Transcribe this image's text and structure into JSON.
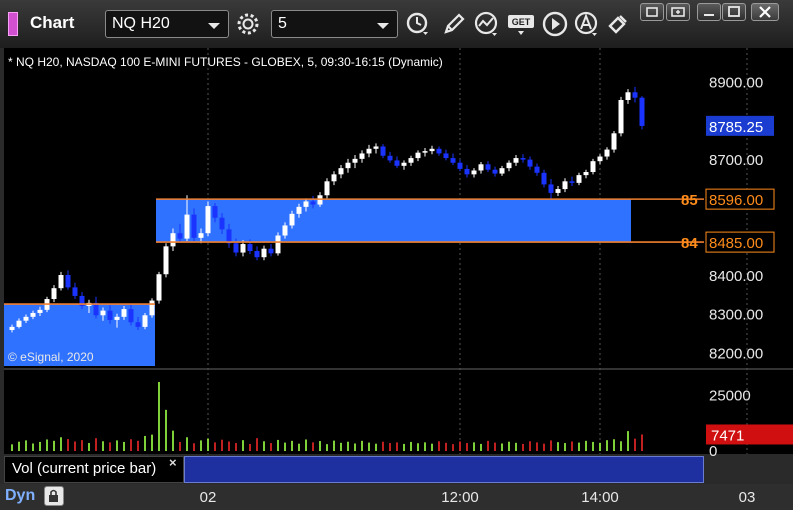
{
  "toolbar": {
    "app_title": "Chart",
    "symbol": "NQ H20",
    "interval": "5",
    "icons": [
      "symbol-dropdown-icon",
      "settings-gear-icon",
      "interval-dropdown-icon",
      "clock-icon",
      "pencil-draw-icon",
      "studies-icon",
      "get-data-icon",
      "play-icon",
      "alert-a-icon",
      "link-chain-icon"
    ],
    "window_buttons": [
      "restore-icon",
      "dock-icon",
      "maximize-icon",
      "close-icon"
    ]
  },
  "chart": {
    "header": "* NQ H20, NASDAQ 100 E-MINI FUTURES - GLOBEX, 5, 09:30-16:15 (Dynamic)",
    "copyright": "© eSignal, 2020",
    "current_price": "8785.25",
    "level_high_value": "8596.00",
    "level_high_tag": "85",
    "level_low_value": "8485.00",
    "level_low_tag": "84",
    "volume_last": "7471",
    "legend_label": "Vol (current price bar)",
    "legend_close": "×",
    "mode_label": "Dyn",
    "colors": {
      "background": "#000000",
      "up_candle": "#ffffff",
      "down_candle": "#1a33ff",
      "zone_fill": "#2f72ff",
      "level_line": "#f08030",
      "level_text": "#ff8c1a",
      "current_price_box": "#1a3cd0",
      "volume_up": "#7fd13a",
      "volume_down": "#c02020",
      "volume_box": "#d01010"
    }
  },
  "chart_data": [
    {
      "type": "candlestick",
      "title": "* NQ H20, NASDAQ 100 E-MINI FUTURES - GLOBEX, 5, 09:30-16:15 (Dynamic)",
      "y_ticks": [
        8200,
        8300,
        8400,
        8500,
        8600,
        8700,
        8800,
        8900
      ],
      "y_tick_labels": [
        "8200.00",
        "8300.00",
        "8400.00",
        "8500.00",
        "8600.00",
        "8700.00",
        "8800.00",
        "8900.00"
      ],
      "ylim": [
        8165,
        8945
      ],
      "x_tick_labels": [
        "02",
        "12:00",
        "14:00",
        "03"
      ],
      "x_tick_bars": [
        28,
        64,
        84,
        105
      ],
      "zones": [
        {
          "from_bar": 0,
          "to_bar": 20,
          "low": 8165,
          "high": 8325
        },
        {
          "from_bar": 21,
          "to_bar": 88,
          "low": 8485,
          "high": 8596
        }
      ],
      "levels": [
        {
          "value": 8596.0,
          "from_bar": 21,
          "to_bar": 88
        },
        {
          "value": 8485.0,
          "from_bar": 21,
          "to_bar": 88
        },
        {
          "value": 8325.0,
          "from_bar": 0,
          "to_bar": 20
        }
      ],
      "candles": [
        [
          8258,
          8272,
          8252,
          8266
        ],
        [
          8266,
          8288,
          8262,
          8282
        ],
        [
          8282,
          8298,
          8276,
          8292
        ],
        [
          8292,
          8308,
          8286,
          8302
        ],
        [
          8302,
          8318,
          8294,
          8310
        ],
        [
          8310,
          8344,
          8304,
          8338
        ],
        [
          8338,
          8374,
          8330,
          8366
        ],
        [
          8366,
          8408,
          8360,
          8400
        ],
        [
          8400,
          8412,
          8362,
          8368
        ],
        [
          8368,
          8380,
          8338,
          8346
        ],
        [
          8346,
          8356,
          8312,
          8320
        ],
        [
          8320,
          8336,
          8302,
          8328
        ],
        [
          8328,
          8344,
          8288,
          8296
        ],
        [
          8296,
          8316,
          8282,
          8308
        ],
        [
          8308,
          8322,
          8274,
          8284
        ],
        [
          8284,
          8300,
          8264,
          8292
        ],
        [
          8292,
          8320,
          8284,
          8312
        ],
        [
          8312,
          8326,
          8270,
          8278
        ],
        [
          8278,
          8292,
          8258,
          8266
        ],
        [
          8266,
          8302,
          8260,
          8296
        ],
        [
          8296,
          8340,
          8290,
          8334
        ],
        [
          8334,
          8408,
          8326,
          8402
        ],
        [
          8402,
          8482,
          8394,
          8474
        ],
        [
          8474,
          8520,
          8462,
          8508
        ],
        [
          8508,
          8532,
          8486,
          8494
        ],
        [
          8494,
          8606,
          8488,
          8556
        ],
        [
          8556,
          8572,
          8488,
          8496
        ],
        [
          8496,
          8520,
          8482,
          8508
        ],
        [
          8508,
          8590,
          8500,
          8578
        ],
        [
          8578,
          8586,
          8536,
          8548
        ],
        [
          8548,
          8560,
          8506,
          8518
        ],
        [
          8518,
          8532,
          8470,
          8482
        ],
        [
          8482,
          8494,
          8448,
          8458
        ],
        [
          8458,
          8490,
          8448,
          8480
        ],
        [
          8480,
          8492,
          8454,
          8462
        ],
        [
          8462,
          8474,
          8438,
          8446
        ],
        [
          8446,
          8476,
          8438,
          8468
        ],
        [
          8468,
          8480,
          8448,
          8456
        ],
        [
          8456,
          8510,
          8450,
          8502
        ],
        [
          8502,
          8536,
          8494,
          8528
        ],
        [
          8528,
          8566,
          8520,
          8558
        ],
        [
          8558,
          8584,
          8548,
          8576
        ],
        [
          8576,
          8598,
          8564,
          8590
        ],
        [
          8590,
          8604,
          8572,
          8582
        ],
        [
          8582,
          8614,
          8576,
          8606
        ],
        [
          8606,
          8650,
          8598,
          8642
        ],
        [
          8642,
          8668,
          8632,
          8660
        ],
        [
          8660,
          8684,
          8650,
          8676
        ],
        [
          8676,
          8700,
          8664,
          8690
        ],
        [
          8690,
          8710,
          8676,
          8700
        ],
        [
          8700,
          8722,
          8690,
          8714
        ],
        [
          8714,
          8736,
          8704,
          8726
        ],
        [
          8726,
          8740,
          8714,
          8732
        ],
        [
          8732,
          8738,
          8702,
          8708
        ],
        [
          8708,
          8718,
          8690,
          8696
        ],
        [
          8696,
          8706,
          8676,
          8682
        ],
        [
          8682,
          8696,
          8672,
          8690
        ],
        [
          8690,
          8708,
          8682,
          8702
        ],
        [
          8702,
          8722,
          8694,
          8716
        ],
        [
          8716,
          8728,
          8706,
          8720
        ],
        [
          8720,
          8734,
          8712,
          8726
        ],
        [
          8726,
          8732,
          8708,
          8714
        ],
        [
          8714,
          8724,
          8696,
          8702
        ],
        [
          8702,
          8714,
          8684,
          8690
        ],
        [
          8690,
          8698,
          8668,
          8674
        ],
        [
          8674,
          8684,
          8652,
          8660
        ],
        [
          8660,
          8676,
          8652,
          8670
        ],
        [
          8670,
          8692,
          8662,
          8686
        ],
        [
          8686,
          8694,
          8666,
          8672
        ],
        [
          8672,
          8680,
          8654,
          8662
        ],
        [
          8662,
          8682,
          8656,
          8676
        ],
        [
          8676,
          8696,
          8668,
          8690
        ],
        [
          8690,
          8710,
          8682,
          8702
        ],
        [
          8702,
          8712,
          8690,
          8698
        ],
        [
          8698,
          8706,
          8672,
          8680
        ],
        [
          8680,
          8688,
          8656,
          8664
        ],
        [
          8664,
          8672,
          8626,
          8634
        ],
        [
          8634,
          8648,
          8596,
          8612
        ],
        [
          8612,
          8630,
          8604,
          8622
        ],
        [
          8622,
          8650,
          8614,
          8642
        ],
        [
          8642,
          8654,
          8630,
          8638
        ],
        [
          8638,
          8664,
          8632,
          8658
        ],
        [
          8658,
          8672,
          8650,
          8666
        ],
        [
          8666,
          8700,
          8660,
          8694
        ],
        [
          8694,
          8712,
          8686,
          8706
        ],
        [
          8706,
          8730,
          8698,
          8724
        ],
        [
          8724,
          8772,
          8716,
          8766
        ],
        [
          8766,
          8860,
          8758,
          8852
        ],
        [
          8852,
          8880,
          8842,
          8872
        ],
        [
          8872,
          8886,
          8846,
          8858
        ],
        [
          8858,
          8862,
          8776,
          8785
        ]
      ]
    },
    {
      "type": "bar",
      "title": "Vol (current price bar)",
      "y_ticks": [
        0,
        25000
      ],
      "y_tick_labels": [
        "0",
        "25000"
      ],
      "ylim": [
        0,
        33000
      ],
      "volumes": [
        3000,
        4200,
        4800,
        3400,
        4100,
        5200,
        4600,
        6200,
        5400,
        4300,
        4900,
        3600,
        5800,
        4400,
        3900,
        4800,
        4100,
        5300,
        4600,
        6800,
        7400,
        31200,
        18600,
        9200,
        4100,
        6200,
        3500,
        4800,
        5600,
        3900,
        5100,
        4300,
        3600,
        4900,
        3200,
        5800,
        4400,
        3600,
        5000,
        3800,
        4600,
        3300,
        5200,
        3900,
        4500,
        3100,
        4700,
        3700,
        4200,
        3400,
        4600,
        3800,
        3300,
        4200,
        3600,
        3900,
        3200,
        4100,
        3500,
        3900,
        3300,
        4400,
        3700,
        3100,
        4300,
        3600,
        3900,
        3200,
        4600,
        3800,
        3400,
        4200,
        3700,
        3200,
        4400,
        3900,
        3300,
        4800,
        4000,
        3600,
        4300,
        3800,
        4600,
        4100,
        3700,
        4900,
        5300,
        4400,
        9000,
        5600,
        7471
      ]
    }
  ]
}
